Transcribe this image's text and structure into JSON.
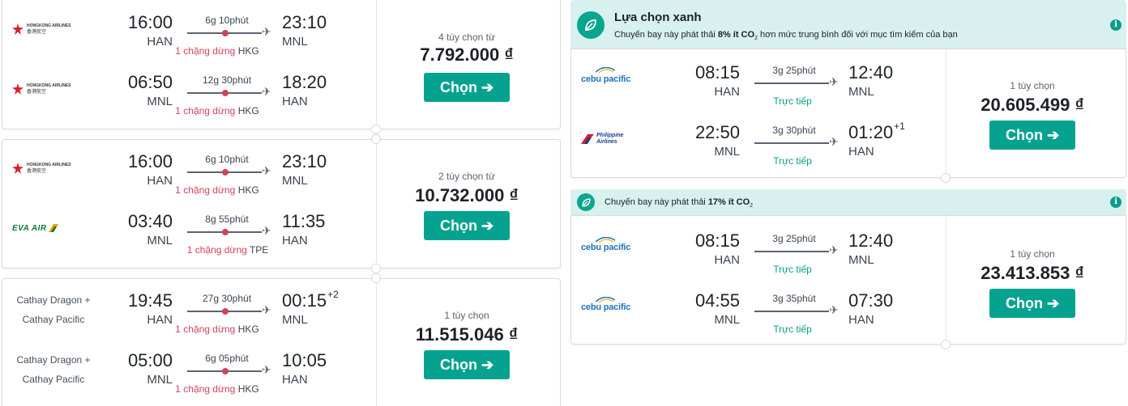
{
  "currency": "₫",
  "colors": {
    "accent": "#05a38f",
    "stop_red": "#d1435b",
    "banner_green": "#d8f1ee"
  },
  "left_cards": [
    {
      "legs": [
        {
          "airline": "Hongkong Airlines",
          "airline_text": "HONGKONG AIRLINES",
          "airline_sub": "香港航空",
          "dep_time": "16:00",
          "dep_ap": "HAN",
          "duration": "6g 10phút",
          "arr_time": "23:10",
          "arr_plus": "",
          "arr_ap": "MNL",
          "stops_text": "1 chặng dừng",
          "stop_ap": "HKG"
        },
        {
          "airline": "Hongkong Airlines",
          "airline_text": "HONGKONG AIRLINES",
          "airline_sub": "香港航空",
          "dep_time": "06:50",
          "dep_ap": "MNL",
          "duration": "12g 30phút",
          "arr_time": "18:20",
          "arr_plus": "",
          "arr_ap": "HAN",
          "stops_text": "1 chặng dừng",
          "stop_ap": "HKG"
        }
      ],
      "options": "4 tùy chọn từ",
      "price": "7.792.000 ₫",
      "button": "Chọn ➔"
    },
    {
      "legs": [
        {
          "airline": "Hongkong Airlines",
          "airline_text": "HONGKONG AIRLINES",
          "airline_sub": "香港航空",
          "dep_time": "16:00",
          "dep_ap": "HAN",
          "duration": "6g 10phút",
          "arr_time": "23:10",
          "arr_plus": "",
          "arr_ap": "MNL",
          "stops_text": "1 chặng dừng",
          "stop_ap": "HKG"
        },
        {
          "airline": "EVA AIR",
          "airline_text": "EVA AIR",
          "airline_sub": "",
          "dep_time": "03:40",
          "dep_ap": "MNL",
          "duration": "8g 55phút",
          "arr_time": "11:35",
          "arr_plus": "",
          "arr_ap": "HAN",
          "stops_text": "1 chặng dừng",
          "stop_ap": "TPE"
        }
      ],
      "options": "2 tùy chọn từ",
      "price": "10.732.000 ₫",
      "button": "Chọn ➔"
    },
    {
      "legs": [
        {
          "airline_line1": "Cathay Dragon +",
          "airline_line2": "Cathay Pacific",
          "dep_time": "19:45",
          "dep_ap": "HAN",
          "duration": "27g 30phút",
          "arr_time": "00:15",
          "arr_plus": "+2",
          "arr_ap": "MNL",
          "stops_text": "1 chặng dừng",
          "stop_ap": "HKG"
        },
        {
          "airline_line1": "Cathay Dragon +",
          "airline_line2": "Cathay Pacific",
          "dep_time": "05:00",
          "dep_ap": "MNL",
          "duration": "6g 05phút",
          "arr_time": "10:05",
          "arr_plus": "",
          "arr_ap": "HAN",
          "stops_text": "1 chặng dừng",
          "stop_ap": "HKG"
        }
      ],
      "options": "1 tùy chọn",
      "price": "11.515.046 ₫",
      "button": "Chọn ➔"
    }
  ],
  "right_cards": [
    {
      "banner_title": "Lựa chọn xanh",
      "banner_sub_pre": "Chuyến bay này phát thải ",
      "banner_sub_bold": "8% ít CO",
      "banner_sub_post": " hơn mức trung bình đối với mục tìm kiếm của bạn",
      "legs": [
        {
          "airline_text": "cebu pacific",
          "dep_time": "08:15",
          "dep_ap": "HAN",
          "duration": "3g 25phút",
          "arr_time": "12:40",
          "arr_plus": "",
          "arr_ap": "MNL",
          "direct": "Trực tiếp"
        },
        {
          "airline_text": "Philippine Airlines",
          "dep_time": "22:50",
          "dep_ap": "MNL",
          "duration": "3g 30phút",
          "arr_time": "01:20",
          "arr_plus": "+1",
          "arr_ap": "HAN",
          "direct": "Trực tiếp"
        }
      ],
      "options": "1 tùy chọn",
      "price": "20.605.499 ₫",
      "button": "Chọn ➔"
    },
    {
      "banner_sub_pre": "Chuyến bay này phát thải ",
      "banner_sub_bold": "17% ít CO",
      "banner_sub_post": "",
      "legs": [
        {
          "airline_text": "cebu pacific",
          "dep_time": "08:15",
          "dep_ap": "HAN",
          "duration": "3g 25phút",
          "arr_time": "12:40",
          "arr_plus": "",
          "arr_ap": "MNL",
          "direct": "Trực tiếp"
        },
        {
          "airline_text": "cebu pacific",
          "dep_time": "04:55",
          "dep_ap": "MNL",
          "duration": "3g 35phút",
          "arr_time": "07:30",
          "arr_plus": "",
          "arr_ap": "HAN",
          "direct": "Trực tiếp"
        }
      ],
      "options": "1 tùy chọn",
      "price": "23.413.853 ₫",
      "button": "Chọn ➔"
    }
  ],
  "icons": {
    "plane": "plane-icon",
    "leaf": "leaf-icon",
    "info": "info-icon"
  }
}
